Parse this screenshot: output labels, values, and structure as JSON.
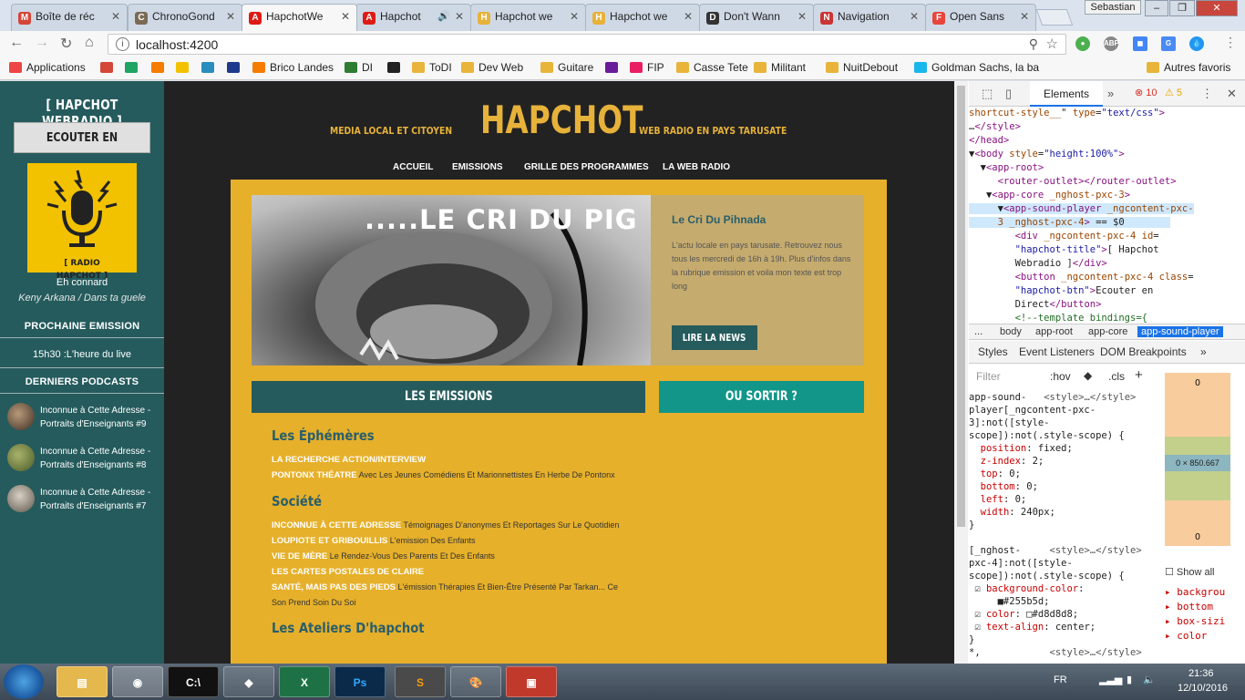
{
  "browser": {
    "tabs": [
      {
        "label": "Boîte de réc",
        "favicon": "gmail-icon",
        "color": "#d44638",
        "glyph": "M"
      },
      {
        "label": "ChronoGond",
        "favicon": "chrono-icon",
        "color": "#7a6a55",
        "glyph": "C"
      },
      {
        "label": "HapchotWe",
        "favicon": "angular-icon",
        "color": "#dd1b16",
        "glyph": "A",
        "active": true
      },
      {
        "label": "Hapchot",
        "favicon": "angular-icon",
        "color": "#dd1b16",
        "glyph": "A",
        "audio": true
      },
      {
        "label": "Hapchot we",
        "favicon": "hapchot-icon",
        "color": "#e7b23a",
        "glyph": "H"
      },
      {
        "label": "Hapchot we",
        "favicon": "hapchot-icon",
        "color": "#e7b23a",
        "glyph": "H"
      },
      {
        "label": "Don't Wann",
        "favicon": "chart-icon",
        "color": "#333333",
        "glyph": "D"
      },
      {
        "label": "Navigation",
        "favicon": "navigation-icon",
        "color": "#c33",
        "glyph": "N"
      },
      {
        "label": "Open Sans",
        "favicon": "fonts-icon",
        "color": "#e8453c",
        "glyph": "F"
      }
    ],
    "user": "Sebastian",
    "url": "localhost:4200",
    "bookmarks": [
      {
        "label": "Applications",
        "icon": "apps-icon"
      },
      {
        "label": "",
        "icon": "gmail-icon"
      },
      {
        "label": "",
        "icon": "drive-icon"
      },
      {
        "label": "",
        "icon": "box-icon"
      },
      {
        "label": "",
        "icon": "mc-icon"
      },
      {
        "label": "",
        "icon": "blabla-icon"
      },
      {
        "label": "",
        "icon": "upr-icon"
      },
      {
        "label": "Brico Landes",
        "icon": "brico-icon"
      },
      {
        "label": "DI",
        "icon": "globe-icon"
      },
      {
        "label": "",
        "icon": "zt-icon"
      },
      {
        "label": "ToDI",
        "icon": "folder-icon"
      },
      {
        "label": "Dev Web",
        "icon": "folder-icon"
      },
      {
        "label": "Guitare",
        "icon": "folder-icon"
      },
      {
        "label": "",
        "icon": "mail-icon"
      },
      {
        "label": "FIP",
        "icon": "fip-icon"
      },
      {
        "label": "Casse Tete",
        "icon": "folder-icon"
      },
      {
        "label": "Militant",
        "icon": "folder-icon"
      },
      {
        "label": "NuitDebout",
        "icon": "folder-icon"
      },
      {
        "label": "Goldman Sachs, la ba",
        "icon": "vimeo-icon"
      },
      {
        "label": "Autres favoris",
        "icon": "folder-icon"
      }
    ]
  },
  "sidebar": {
    "title": "[ HAPCHOT WEBRADIO ]",
    "listen_button": "ECOUTER EN DIRECT",
    "logo_label": "[ RADIO HAPCHOT ]",
    "now_playing_title": "Eh connard",
    "now_playing_artist": "Keny Arkana / Dans ta guele",
    "next_heading": "PROCHAINE EMISSION",
    "next_show": "15h30 :L'heure du live",
    "podcasts_heading": "DERNIERS PODCASTS",
    "podcasts": [
      {
        "title": "Inconnue à Cette Adresse - Portraits d'Enseignants #9"
      },
      {
        "title": "Inconnue à Cette Adresse - Portraits d'Enseignants #8"
      },
      {
        "title": "Inconnue à Cette Adresse - Portraits d'Enseignants #7"
      }
    ]
  },
  "site": {
    "tagline_left": "MEDIA LOCAL ET CITOYEN",
    "logo": "HAPCHOT",
    "tagline_right": "WEB RADIO EN PAYS TARUSATE",
    "nav": [
      "ACCUEIL",
      "EMISSIONS",
      "GRILLE DES PROGRAMMES",
      "LA WEB RADIO"
    ],
    "hero": {
      "image_caption": ".....LE CRI DU PIG",
      "title": "Le Cri Du Pihnada",
      "description": "L'actu locale en pays tarusate. Retrouvez nous tous les mercredi de 16h à 19h. Plus d'infos dans la rubrique emission et voila mon texte est trop long",
      "button": "LIRE LA NEWS"
    },
    "btn_emissions": "LES EMISSIONS",
    "btn_sortir": "OU SORTIR ?",
    "categories": [
      {
        "title": "Les Éphémères",
        "items": [
          {
            "name": "LA RECHERCHE ACTION/INTERVIEW",
            "desc": ""
          },
          {
            "name": "PONTONX THÉATRE",
            "desc": "Avec Les Jeunes Comédiens Et Marionnettistes En Herbe De Pontonx"
          }
        ]
      },
      {
        "title": "Société",
        "items": [
          {
            "name": "INCONNUE À CETTE ADRESSE",
            "desc": "Témoignages D'anonymes Et Reportages Sur Le Quotidien"
          },
          {
            "name": "LOUPIOTE ET GRIBOUILLIS",
            "desc": "L'emission Des Enfants"
          },
          {
            "name": "VIE DE MÈRE",
            "desc": "Le Rendez-Vous Des Parents Et Des Enfants"
          },
          {
            "name": "LES CARTES POSTALES DE CLAIRE",
            "desc": ""
          },
          {
            "name": "SANTÉ, MAIS PAS DES PIEDS",
            "desc": "L'émission Thérapies Et Bien-Être Présenté Par Tarkan... Ce Son Prend Soin Du Soi"
          }
        ]
      },
      {
        "title": "Les Ateliers D'hapchot",
        "items": []
      }
    ]
  },
  "devtools": {
    "tab_elements": "Elements",
    "errors": "10",
    "warnings": "5",
    "crumbs": [
      "...",
      "body",
      "app-root",
      "app-core",
      "app-sound-player"
    ],
    "subtabs": [
      "Styles",
      "Event Listeners",
      "DOM Breakpoints"
    ],
    "filter_placeholder": "Filter",
    "hov": ":hov",
    "cls": ".cls",
    "box_value": "0 × 850.667",
    "box_top": "0",
    "box_bottom": "0",
    "show_all": "Show all",
    "computed_props": [
      "backgrou",
      "bottom",
      "box-sizi",
      "color"
    ]
  },
  "taskbar": {
    "lang": "FR",
    "time": "21:36",
    "date": "12/10/2016"
  },
  "colors": {
    "sidebar_bg": "#255b5d",
    "accent_gold": "#e7b23a",
    "content_bg": "#e6b02a",
    "teal_button": "#12968a"
  }
}
